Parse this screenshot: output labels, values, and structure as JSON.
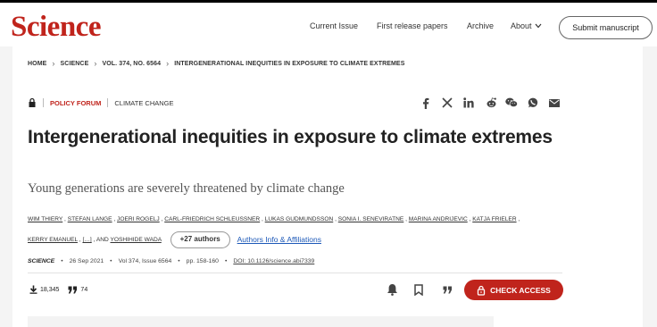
{
  "brand": {
    "logo": "Science",
    "accent": "#c0241c"
  },
  "nav": {
    "current_issue": "Current Issue",
    "first_release": "First release papers",
    "archive": "Archive",
    "about": "About",
    "submit": "Submit manuscript"
  },
  "breadcrumb": [
    "HOME",
    "SCIENCE",
    "VOL. 374, NO. 6564",
    "INTERGENERATIONAL INEQUITIES IN EXPOSURE TO CLIMATE EXTREMES"
  ],
  "article": {
    "section": "POLICY FORUM",
    "topic": "CLIMATE CHANGE",
    "title": "Intergenerational inequities in exposure to climate extremes",
    "subtitle": "Young generations are severely threatened by climate change",
    "authors_line1": [
      "WIM THIERY",
      "STEFAN LANGE",
      "JOERI ROGELJ",
      "CARL-FRIEDRICH SCHLEUSSNER",
      "LUKAS GUDMUNDSSON",
      "SONIA I. SENEVIRATNE",
      "MARINA ANDRIJEVIC",
      "KATJA FRIELER"
    ],
    "authors_line2_a": "KERRY EMANUEL",
    "authors_line2_ellipsis": "[…]",
    "authors_line2_and": "AND",
    "authors_line2_b": "YOSHIHIDE WADA",
    "more_authors": "+27 authors",
    "affiliations": "Authors Info & Affiliations",
    "journal": "SCIENCE",
    "date": "26 Sep 2021",
    "volume": "Vol 374, Issue 6564",
    "pages": "pp. 158-160",
    "doi": "DOI: 10.1126/science.abi7339",
    "views": "18,345",
    "citations": "74",
    "check_access": "CHECK ACCESS"
  },
  "icons": {
    "share": [
      "facebook-icon",
      "x-icon",
      "linkedin-icon",
      "reddit-icon",
      "wechat-icon",
      "whatsapp-icon",
      "email-icon"
    ]
  }
}
